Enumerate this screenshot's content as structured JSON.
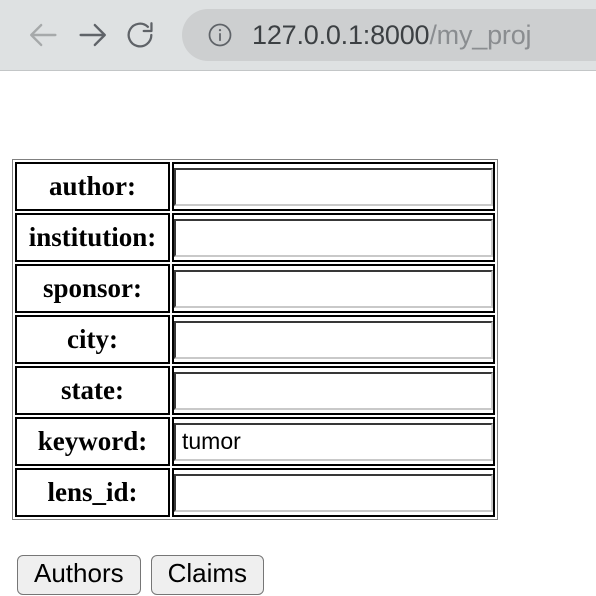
{
  "browser": {
    "back_icon": "arrow-left-icon",
    "forward_icon": "arrow-right-icon",
    "reload_icon": "reload-icon",
    "site_info_icon": "info-circle-icon",
    "url_host": "127.0.0.1:8000",
    "url_path": "/my_proj",
    "url_full": "127.0.0.1:8000/my_proj",
    "toolbar_bg": "#dee1e2",
    "urlbar_bg": "#cdcfd0"
  },
  "form": {
    "rows": [
      {
        "label": "author:",
        "value": "",
        "field": "author"
      },
      {
        "label": "institution:",
        "value": "",
        "field": "institution"
      },
      {
        "label": "sponsor:",
        "value": "",
        "field": "sponsor"
      },
      {
        "label": "city:",
        "value": "",
        "field": "city"
      },
      {
        "label": "state:",
        "value": "",
        "field": "state"
      },
      {
        "label": "keyword:",
        "value": "tumor",
        "field": "keyword"
      },
      {
        "label": "lens_id:",
        "value": "",
        "field": "lens_id"
      }
    ],
    "buttons": [
      {
        "label": "Authors",
        "name": "authors-button"
      },
      {
        "label": "Claims",
        "name": "claims-button"
      }
    ]
  }
}
